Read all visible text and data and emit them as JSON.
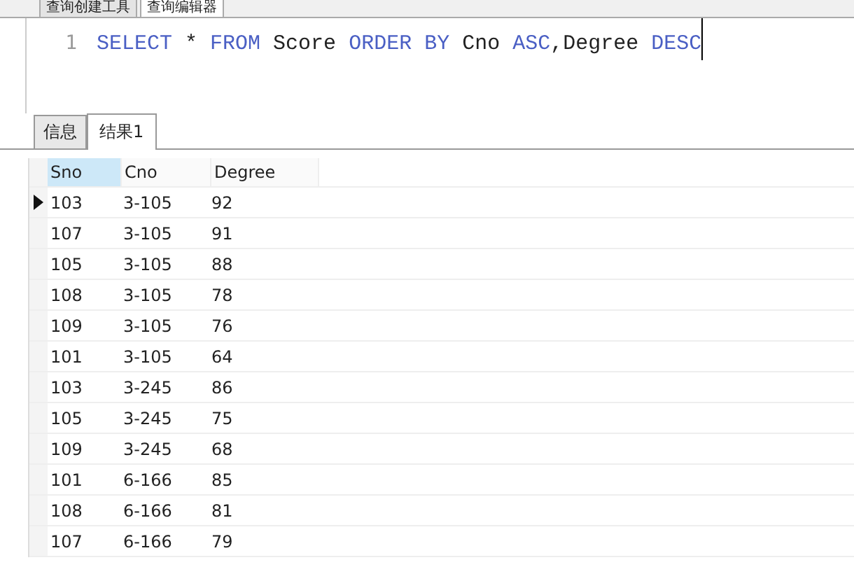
{
  "top_tabs": [
    {
      "label": "查询创建工具",
      "selected": false
    },
    {
      "label": "查询编辑器",
      "selected": true
    }
  ],
  "editor": {
    "lines": [
      {
        "number": "1",
        "tokens": [
          {
            "text": "SELECT",
            "kind": "keyword"
          },
          {
            "text": " * ",
            "kind": "plain"
          },
          {
            "text": "FROM",
            "kind": "keyword"
          },
          {
            "text": " Score ",
            "kind": "plain"
          },
          {
            "text": "ORDER BY",
            "kind": "keyword"
          },
          {
            "text": " Cno ",
            "kind": "plain"
          },
          {
            "text": "ASC",
            "kind": "keyword"
          },
          {
            "text": ",Degree ",
            "kind": "plain"
          },
          {
            "text": "DESC",
            "kind": "keyword"
          }
        ]
      }
    ]
  },
  "result_tabs": [
    {
      "label": "信息",
      "selected": false
    },
    {
      "label": "结果1",
      "selected": true
    }
  ],
  "table": {
    "columns": [
      {
        "label": "Sno",
        "selected": true
      },
      {
        "label": "Cno",
        "selected": false
      },
      {
        "label": "Degree",
        "selected": false
      }
    ],
    "rows": [
      {
        "cells": [
          "103",
          "3-105",
          "92"
        ],
        "selected": true
      },
      {
        "cells": [
          "107",
          "3-105",
          "91"
        ],
        "selected": false
      },
      {
        "cells": [
          "105",
          "3-105",
          "88"
        ],
        "selected": false
      },
      {
        "cells": [
          "108",
          "3-105",
          "78"
        ],
        "selected": false
      },
      {
        "cells": [
          "109",
          "3-105",
          "76"
        ],
        "selected": false
      },
      {
        "cells": [
          "101",
          "3-105",
          "64"
        ],
        "selected": false
      },
      {
        "cells": [
          "103",
          "3-245",
          "86"
        ],
        "selected": false
      },
      {
        "cells": [
          "105",
          "3-245",
          "75"
        ],
        "selected": false
      },
      {
        "cells": [
          "109",
          "3-245",
          "68"
        ],
        "selected": false
      },
      {
        "cells": [
          "101",
          "6-166",
          "85"
        ],
        "selected": false
      },
      {
        "cells": [
          "108",
          "6-166",
          "81"
        ],
        "selected": false
      },
      {
        "cells": [
          "107",
          "6-166",
          "79"
        ],
        "selected": false
      }
    ]
  }
}
